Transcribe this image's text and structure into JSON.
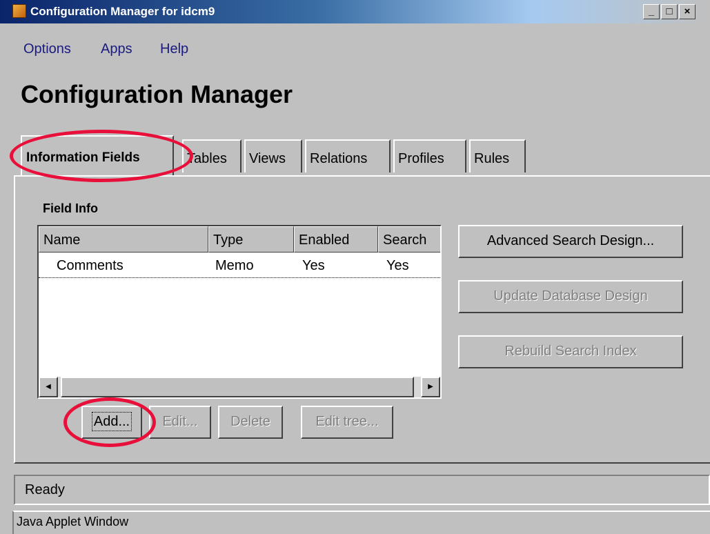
{
  "window": {
    "title": "Configuration Manager for idcm9",
    "controls": {
      "minimize": "_",
      "maximize": "□",
      "close": "×"
    }
  },
  "menu": [
    "Options",
    "Apps",
    "Help"
  ],
  "heading": "Configuration Manager",
  "tabs": [
    "Information Fields",
    "Tables",
    "Views",
    "Relations",
    "Profiles",
    "Rules"
  ],
  "active_tab": "Information Fields",
  "field_info": {
    "label": "Field Info",
    "columns": [
      "Name",
      "Type",
      "Enabled",
      "Search"
    ],
    "rows": [
      {
        "name": "Comments",
        "type": "Memo",
        "enabled": "Yes",
        "search": "Yes"
      }
    ]
  },
  "buttons": {
    "add": "Add...",
    "edit": "Edit...",
    "delete": "Delete",
    "edit_tree": "Edit tree...",
    "advanced_search": "Advanced Search Design...",
    "update_db": "Update Database Design",
    "rebuild_index": "Rebuild Search Index"
  },
  "status": "Ready",
  "applet_label": "Java Applet Window",
  "colors": {
    "annotation": "#e8103a",
    "titlebar": "#0a246a",
    "disabled_text": "#808080"
  },
  "icons": {
    "scroll_left": "◀",
    "scroll_right": "▶"
  }
}
